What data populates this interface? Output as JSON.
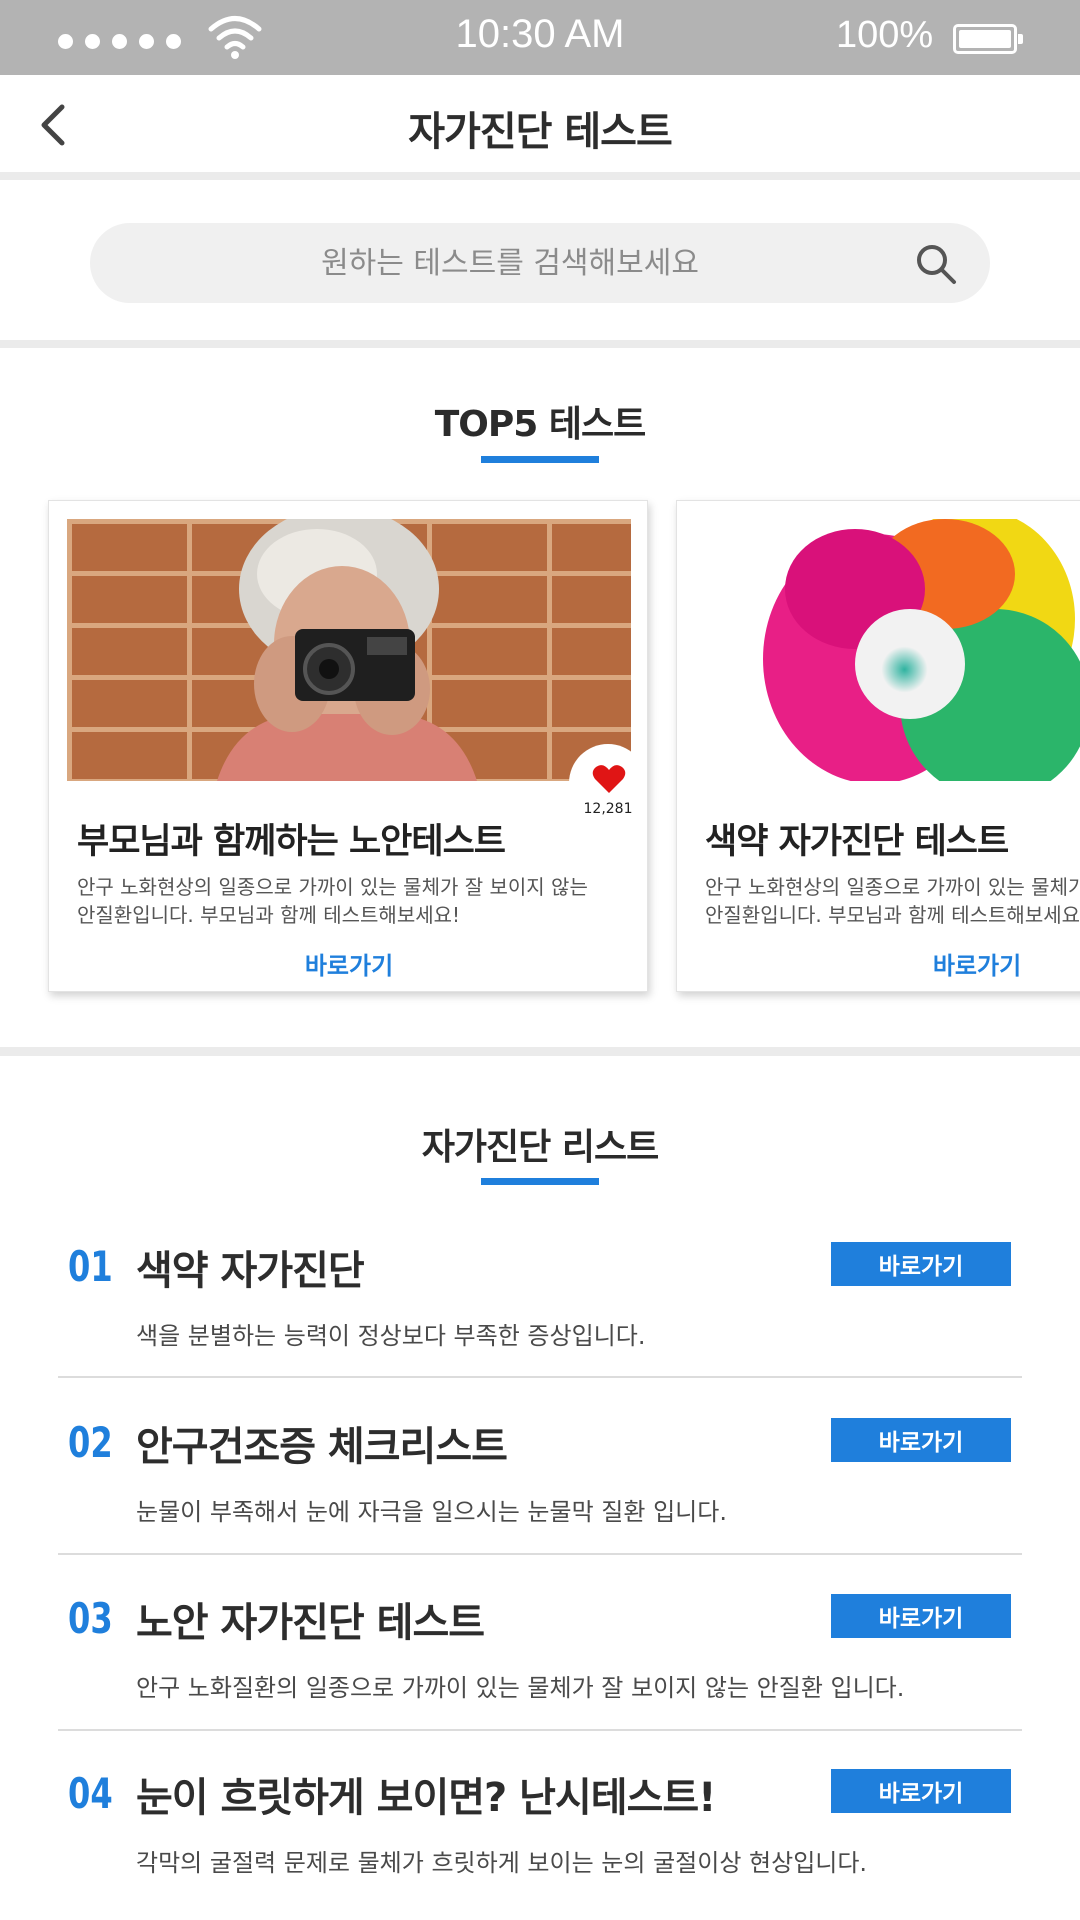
{
  "status_bar": {
    "time": "10:30 AM",
    "battery": "100%"
  },
  "header": {
    "title": "자가진단 테스트"
  },
  "search": {
    "placeholder": "원하는 테스트를 검색해보세요"
  },
  "top5": {
    "title": "TOP5 테스트",
    "cards": [
      {
        "title": "부모님과 함께하는 노안테스트",
        "description": "안구 노화현상의 일종으로 가까이 있는 물체가 잘 보이지 않는\n안질환입니다. 부모님과 함께 테스트해보세요!",
        "link": "바로가기",
        "likes": "12,281"
      },
      {
        "title": "색약 자가진단 테스트",
        "description": "안구 노화현상의 일종으로 가까이 있는 물체가 잘 보이지 않는\n안질환입니다. 부모님과 함께 테스트해보세요!",
        "link": "바로가기"
      }
    ]
  },
  "list": {
    "title": "자가진단 리스트",
    "items": [
      {
        "num": "01",
        "title": "색약 자가진단",
        "description": "색을 분별하는 능력이 정상보다 부족한 증상입니다.",
        "button": "바로가기"
      },
      {
        "num": "02",
        "title": "안구건조증 체크리스트",
        "description": "눈물이 부족해서 눈에 자극을 일으시는 눈물막 질환 입니다.",
        "button": "바로가기"
      },
      {
        "num": "03",
        "title": "노안 자가진단 테스트",
        "description": "안구 노화질환의 일종으로 가까이 있는 물체가 잘 보이지 않는 안질환 입니다.",
        "button": "바로가기"
      },
      {
        "num": "04",
        "title": "눈이 흐릿하게 보이면? 난시테스트!",
        "description": "각막의 굴절력 문제로 물체가 흐릿하게 보이는 눈의 굴절이상 현상입니다.",
        "button": "바로가기"
      }
    ]
  },
  "colors": {
    "accent": "#1f7fdc",
    "status_bar": "#b3b3b3",
    "divider": "#ebebeb",
    "heart": "#e01515"
  }
}
